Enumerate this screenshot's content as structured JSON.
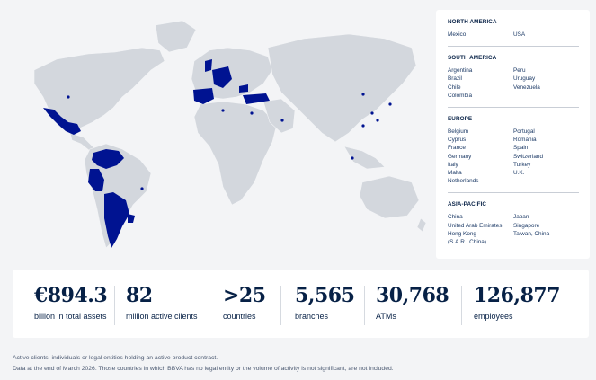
{
  "colors": {
    "presence": "#001391",
    "land": "#d3d7dd",
    "dot": "#001391"
  },
  "regions": [
    {
      "title": "NORTH AMERICA",
      "left": [
        "Mexico"
      ],
      "right": [
        "USA"
      ]
    },
    {
      "title": "SOUTH AMERICA",
      "left": [
        "Argentina",
        "Brazil",
        "Chile",
        "Colombia"
      ],
      "right": [
        "Peru",
        "Uruguay",
        "Venezuela"
      ]
    },
    {
      "title": "EUROPE",
      "left": [
        "Belgium",
        "Cyprus",
        "France",
        "Germany",
        "Italy",
        "Malta",
        "Netherlands"
      ],
      "right": [
        "Portugal",
        "Romania",
        "Spain",
        "Switzerland",
        "Turkey",
        "U.K."
      ]
    },
    {
      "title": "ASIA-PACIFIC",
      "left": [
        "China",
        "United Arab Emirates",
        "Hong Kong",
        "(S.A.R., China)"
      ],
      "right": [
        "Japan",
        "Singapore",
        "Taiwan, China"
      ]
    }
  ],
  "stats": [
    {
      "value": "€894.3",
      "label": "billion in total assets"
    },
    {
      "value": "82",
      "label": "million active clients"
    },
    {
      "value": ">25",
      "label": "countries"
    },
    {
      "value": "5,565",
      "label": "branches"
    },
    {
      "value": "30,768",
      "label": "ATMs"
    },
    {
      "value": "126,877",
      "label": "employees"
    }
  ],
  "footnotes": [
    "Active clients: individuals or legal entities holding an active product contract.",
    "Data at the end of March 2026. Those countries in which BBVA has no legal entity or the volume of activity is not significant, are not included."
  ]
}
